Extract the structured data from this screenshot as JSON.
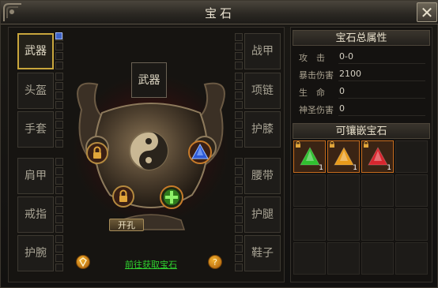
{
  "window": {
    "title": "宝石",
    "close_label": "✕"
  },
  "equipment": {
    "left": [
      {
        "label": "武器",
        "active": true
      },
      {
        "label": "头盔"
      },
      {
        "label": "手套"
      },
      {
        "label": "肩甲"
      },
      {
        "label": "戒指"
      },
      {
        "label": "护腕"
      }
    ],
    "right": [
      {
        "label": "战甲"
      },
      {
        "label": "项链"
      },
      {
        "label": "护膝"
      },
      {
        "label": "腰带"
      },
      {
        "label": "护腿"
      },
      {
        "label": "鞋子"
      }
    ],
    "selected_slot_label": "武器"
  },
  "socket": {
    "open_button": "开孔",
    "get_gems_link": "前往获取宝石",
    "help_icon": "?",
    "add_icon": "+"
  },
  "stats": {
    "header": "宝石总属性",
    "rows": [
      {
        "label": "攻　击",
        "value": "0-0"
      },
      {
        "label": "暴击伤害",
        "value": "2100"
      },
      {
        "label": "生　命",
        "value": "0"
      },
      {
        "label": "神圣伤害",
        "value": "0"
      }
    ]
  },
  "inlay": {
    "header": "可镶嵌宝石",
    "gems": [
      {
        "name": "green-gem",
        "count": "1",
        "color": "#2fbf2f"
      },
      {
        "name": "orange-gem",
        "count": "1",
        "color": "#e89a1a"
      },
      {
        "name": "red-gem",
        "count": "1",
        "color": "#d8262e"
      }
    ]
  },
  "colors": {
    "accent_gold": "#c9a63c",
    "link_green": "#2fd22f"
  }
}
